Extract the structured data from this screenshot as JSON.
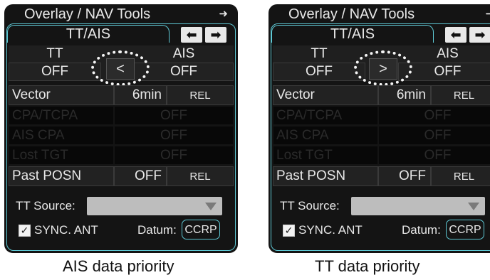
{
  "panels": [
    {
      "title": "Overlay / NAV Tools",
      "title_arrow": "➜",
      "tab": "TT/AIS",
      "nav_left": "⬅",
      "nav_right": "➡",
      "tt_label": "TT",
      "ais_label": "AIS",
      "tt_value": "OFF",
      "ais_value": "OFF",
      "priority_toggle": "<",
      "rows": [
        {
          "label": "Vector",
          "value": "6min",
          "mode": "REL",
          "enabled": true
        },
        {
          "label": "CPA/TCPA",
          "value": "OFF",
          "mode": "",
          "enabled": false
        },
        {
          "label": "AIS CPA",
          "value": "OFF",
          "mode": "",
          "enabled": false
        },
        {
          "label": "Lost TGT",
          "value": "OFF",
          "mode": "",
          "enabled": false
        },
        {
          "label": "Past POSN",
          "value": "OFF",
          "mode": "REL",
          "enabled": true
        }
      ],
      "tt_source_label": "TT Source:",
      "sync_label": "SYNC. ANT",
      "sync_checked": "✓",
      "datum_label": "Datum:",
      "datum_value": "CCRP",
      "caption": "AIS data priority"
    },
    {
      "title": "Overlay / NAV Tools",
      "title_arrow": "➜",
      "tab": "TT/AIS",
      "nav_left": "⬅",
      "nav_right": "➡",
      "tt_label": "TT",
      "ais_label": "AIS",
      "tt_value": "OFF",
      "ais_value": "OFF",
      "priority_toggle": ">",
      "rows": [
        {
          "label": "Vector",
          "value": "6min",
          "mode": "REL",
          "enabled": true
        },
        {
          "label": "CPA/TCPA",
          "value": "OFF",
          "mode": "",
          "enabled": false
        },
        {
          "label": "AIS CPA",
          "value": "OFF",
          "mode": "",
          "enabled": false
        },
        {
          "label": "Lost TGT",
          "value": "OFF",
          "mode": "",
          "enabled": false
        },
        {
          "label": "Past POSN",
          "value": "OFF",
          "mode": "REL",
          "enabled": true
        }
      ],
      "tt_source_label": "TT Source:",
      "sync_label": "SYNC. ANT",
      "sync_checked": "✓",
      "datum_label": "Datum:",
      "datum_value": "CCRP",
      "caption": "TT data priority"
    }
  ],
  "colors": {
    "accent": "#5ec8d4",
    "panel_bg": "#141414",
    "text": "#e8e8e8"
  }
}
